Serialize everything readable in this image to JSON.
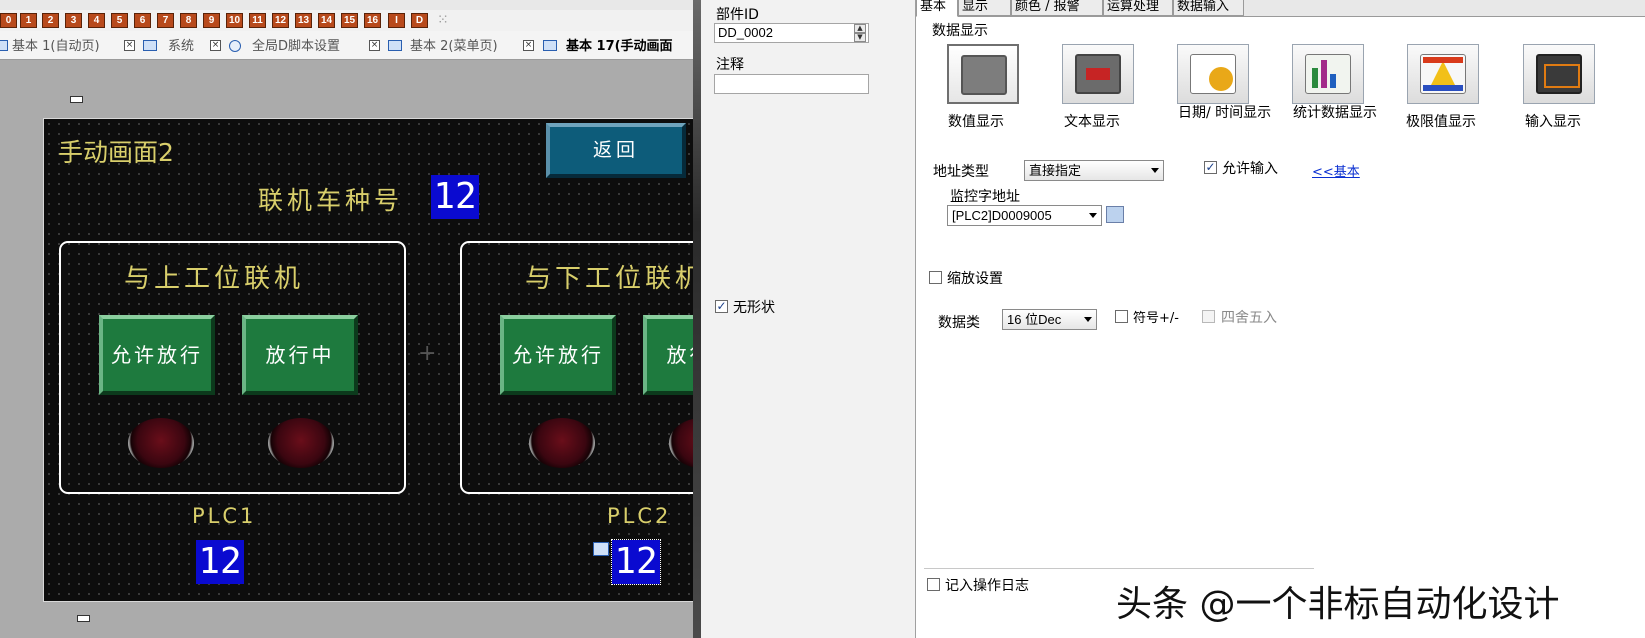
{
  "layer_toolbar": {
    "buttons": [
      "0",
      "1",
      "2",
      "3",
      "4",
      "5",
      "6",
      "7",
      "8",
      "9",
      "10",
      "11",
      "12",
      "13",
      "14",
      "15",
      "16",
      "I",
      "D"
    ]
  },
  "page_tabs": [
    {
      "label": "基本 1(自动页)"
    },
    {
      "label": "系统"
    },
    {
      "label": "全局D脚本设置"
    },
    {
      "label": "基本 2(菜单页)"
    },
    {
      "label": "基本 17(手动画面"
    }
  ],
  "screen": {
    "title": "手动画面2",
    "back_button": "返回",
    "link_label": "联机车种号",
    "link_value": "12",
    "panel_left": {
      "title": "与上工位联机",
      "btn_allow": "允许放行",
      "btn_passing": "放行中"
    },
    "panel_right": {
      "title": "与下工位联机",
      "btn_allow": "允许放行",
      "btn_passing": "放行中"
    },
    "plc1_label": "PLC1",
    "plc1_value": "12",
    "plc2_label": "PLC2",
    "plc2_value": "12"
  },
  "props": {
    "id_label": "部件ID",
    "id_value": "DD_0002",
    "comment_label": "注释",
    "comment_value": "",
    "shapeless_label": "无形状",
    "shapeless_checked": true
  },
  "dialog": {
    "tabs": [
      "基本",
      "显示",
      "颜色 / 报警",
      "运算处理",
      "数据输入"
    ],
    "section_label": "数据显示",
    "tiles": [
      {
        "label": "数值显示",
        "icon": "numeric-display-icon",
        "color": "#7d7d7d"
      },
      {
        "label": "文本显示",
        "icon": "text-display-icon",
        "color": "#c62424"
      },
      {
        "label": "日期/ 时间显示",
        "icon": "date-time-icon",
        "color": "#e9a818"
      },
      {
        "label": "统计数据显示",
        "icon": "statistics-icon",
        "color": "#2b8a3e"
      },
      {
        "label": "极限值显示",
        "icon": "limit-value-icon",
        "color": "#d93a1a"
      },
      {
        "label": "输入显示",
        "icon": "input-display-icon",
        "color": "#e07b12"
      }
    ],
    "address_type_label": "地址类型",
    "address_type_value": "直接指定",
    "allow_input_label": "允许输入",
    "allow_input_checked": true,
    "basic_link": "<<基本",
    "monitor_label": "监控字地址",
    "monitor_value": "[PLC2]D0009005",
    "scale_label": "缩放设置",
    "scale_checked": false,
    "data_type_label": "数据类",
    "data_type_value": "16 位Dec",
    "sign_label": "符号+/-",
    "sign_checked": false,
    "round_label": "四舍五入",
    "round_checked": false,
    "log_label": "记入操作日志",
    "log_checked": false
  },
  "watermark": "头条 @一个非标自动化设计",
  "colors": {
    "hmi_yellow": "#d9cf6b",
    "hmi_number_bg": "#0a0ad0",
    "hmi_button_green": "#1e7a3e",
    "hmi_back_button": "#0d5c7a",
    "link_blue": "#0a2fd1"
  }
}
